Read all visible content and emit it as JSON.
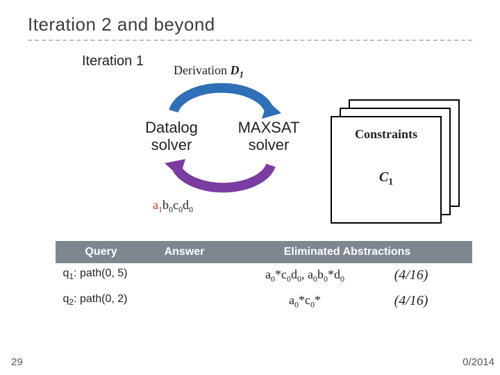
{
  "title": "Iteration 2 and beyond",
  "iteration_label": "Iteration 1",
  "derivation": {
    "word": "Derivation ",
    "sym": "D",
    "sub": "1"
  },
  "solver_left": "Datalog solver",
  "solver_right": "MAXSAT solver",
  "abstraction_below": {
    "tokens": [
      {
        "t": "a",
        "color": "r"
      },
      {
        "t": "1",
        "sub": true,
        "color": "r"
      },
      {
        "t": "b"
      },
      {
        "t": "0",
        "sub": true
      },
      {
        "t": "c"
      },
      {
        "t": "0",
        "sub": true
      },
      {
        "t": "d"
      },
      {
        "t": "0",
        "sub": true
      }
    ]
  },
  "constraints": {
    "title": "Constraints",
    "sym": "C",
    "sub": "1"
  },
  "table": {
    "headers": [
      "Query",
      "Answer",
      "Eliminated Abstractions"
    ],
    "rows": [
      {
        "q_label": "q",
        "q_sub": "1",
        "q_rest": ": path(0, 5)",
        "answer": "",
        "elim_html": "a<sub>0</sub>*c<sub>0</sub>d<sub>0</sub>, a<sub>0</sub>b<sub>0</sub>*d<sub>0</sub>",
        "frac": "(4/16)"
      },
      {
        "q_label": "q",
        "q_sub": "2",
        "q_rest": ": path(0, 2)",
        "answer": "",
        "elim_html": "a<sub>0</sub>*c<sub>0</sub>*",
        "frac": "(4/16)"
      }
    ]
  },
  "page_number": "29",
  "date_fragment": "0/2014"
}
